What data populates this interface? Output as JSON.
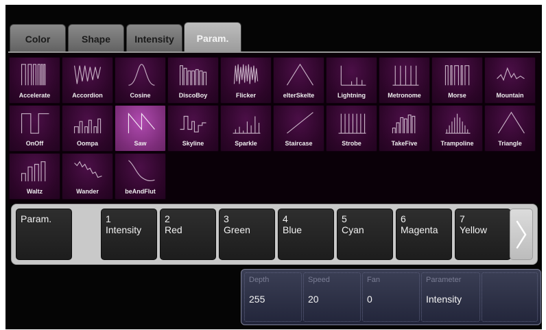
{
  "tabs": [
    {
      "label": "Color",
      "active": false
    },
    {
      "label": "Shape",
      "active": false
    },
    {
      "label": "Intensity",
      "active": false
    },
    {
      "label": "Param.",
      "active": true
    }
  ],
  "effects": [
    {
      "label": "Accelerate",
      "icon": "accelerate-waveform-icon"
    },
    {
      "label": "Accordion",
      "icon": "accordion-waveform-icon"
    },
    {
      "label": "Cosine",
      "icon": "cosine-waveform-icon"
    },
    {
      "label": "DiscoBoy",
      "icon": "discoboy-waveform-icon"
    },
    {
      "label": "Flicker",
      "icon": "flicker-waveform-icon"
    },
    {
      "label": "elterSkelte",
      "icon": "helterskelter-waveform-icon"
    },
    {
      "label": "Lightning",
      "icon": "lightning-waveform-icon"
    },
    {
      "label": "Metronome",
      "icon": "metronome-waveform-icon"
    },
    {
      "label": "Morse",
      "icon": "morse-waveform-icon"
    },
    {
      "label": "Mountain",
      "icon": "mountain-waveform-icon"
    },
    {
      "label": "OnOff",
      "icon": "onoff-waveform-icon"
    },
    {
      "label": "Oompa",
      "icon": "oompa-waveform-icon"
    },
    {
      "label": "Saw",
      "icon": "saw-waveform-icon",
      "selected": true
    },
    {
      "label": "Skyline",
      "icon": "skyline-waveform-icon"
    },
    {
      "label": "Sparkle",
      "icon": "sparkle-waveform-icon"
    },
    {
      "label": "Staircase",
      "icon": "staircase-waveform-icon"
    },
    {
      "label": "Strobe",
      "icon": "strobe-waveform-icon"
    },
    {
      "label": "TakeFive",
      "icon": "takefive-waveform-icon"
    },
    {
      "label": "Trampoline",
      "icon": "trampoline-waveform-icon"
    },
    {
      "label": "Triangle",
      "icon": "triangle-waveform-icon"
    },
    {
      "label": "Waltz",
      "icon": "waltz-waveform-icon"
    },
    {
      "label": "Wander",
      "icon": "wander-waveform-icon"
    },
    {
      "label": "beAndFlut",
      "icon": "ebbandflutter-waveform-icon"
    }
  ],
  "param_bar": {
    "label": "Param.",
    "items": [
      {
        "num": "1",
        "name": "Intensity"
      },
      {
        "num": "2",
        "name": "Red"
      },
      {
        "num": "3",
        "name": "Green"
      },
      {
        "num": "4",
        "name": "Blue"
      },
      {
        "num": "5",
        "name": "Cyan"
      },
      {
        "num": "6",
        "name": "Magenta"
      },
      {
        "num": "7",
        "name": "Yellow"
      }
    ],
    "next_icon": "chevron-right-icon"
  },
  "info": [
    {
      "head": "Depth",
      "value": "255"
    },
    {
      "head": "Speed",
      "value": "20"
    },
    {
      "head": "Fan",
      "value": "0"
    },
    {
      "head": "Parameter",
      "value": "Intensity"
    },
    {
      "head": "",
      "value": ""
    }
  ],
  "colors": {
    "tile": "#2c0528",
    "tile_selected": "#8a3a87",
    "background": "#050505",
    "param_bar": "#c9c9c9"
  }
}
